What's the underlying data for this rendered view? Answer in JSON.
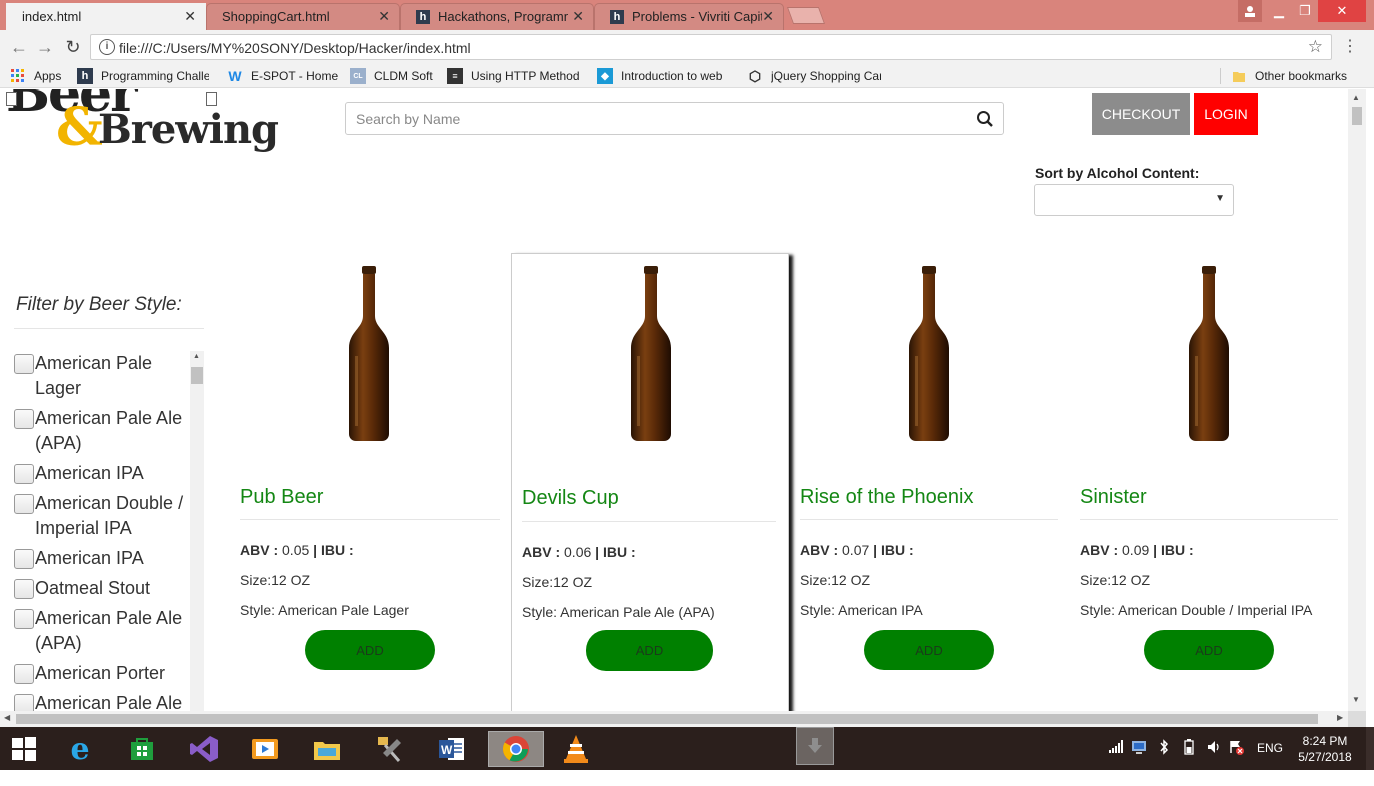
{
  "browser": {
    "tabs": [
      {
        "title": "index.html",
        "icon": "page-icon",
        "active": true
      },
      {
        "title": "ShoppingCart.html",
        "icon": "page-icon",
        "active": false
      },
      {
        "title": "Hackathons, Programmin",
        "icon": "hackerearth-icon",
        "active": false
      },
      {
        "title": "Problems - Vivriti Capital",
        "icon": "hackerearth-icon",
        "active": false
      }
    ],
    "url": "file:///C:/Users/MY%20SONY/Desktop/Hacker/index.html",
    "bookmarks": [
      {
        "label": "Apps",
        "icon": "apps-grid-icon"
      },
      {
        "label": "Programming Challe",
        "icon": "hackerearth-icon"
      },
      {
        "label": "E-SPOT - Home",
        "icon": "w-logo-icon"
      },
      {
        "label": "CLDM Soft",
        "icon": "cldm-icon"
      },
      {
        "label": "Using HTTP Method",
        "icon": "doc-icon"
      },
      {
        "label": "Introduction to web",
        "icon": "web-icon"
      },
      {
        "label": "jQuery Shopping Car",
        "icon": "codepen-icon"
      }
    ],
    "other_bookmarks": "Other bookmarks"
  },
  "header": {
    "logo_top": "Beer",
    "logo_amp": "&",
    "logo_brewing": "Brewing",
    "search_placeholder": "Search by Name",
    "checkout_label": "CHECKOUT",
    "login_label": "LOGIN",
    "colors": {
      "checkout_bg": "#8c8c8c",
      "login_bg": "#ff0000"
    }
  },
  "sort": {
    "label": "Sort by Alcohol Content:",
    "selected": ""
  },
  "filter": {
    "title": "Filter by Beer Style:",
    "items": [
      "American Pale Lager",
      "American Pale Ale (APA)",
      "American IPA",
      "American Double / Imperial IPA",
      "American IPA",
      "Oatmeal Stout",
      "American Pale Ale (APA)",
      "American Porter",
      "American Pale Ale (APA)"
    ]
  },
  "products": [
    {
      "name": "Pub Beer",
      "abv_label": "ABV :",
      "abv": "0.05",
      "ibu_label": "| IBU :",
      "size": "Size:12 OZ",
      "style": "Style: American Pale Lager",
      "add": "ADD"
    },
    {
      "name": "Devils Cup",
      "abv_label": "ABV :",
      "abv": "0.06",
      "ibu_label": "| IBU :",
      "size": "Size:12 OZ",
      "style": "Style: American Pale Ale (APA)",
      "add": "ADD"
    },
    {
      "name": "Rise of the Phoenix",
      "abv_label": "ABV :",
      "abv": "0.07",
      "ibu_label": "| IBU :",
      "size": "Size:12 OZ",
      "style": "Style: American IPA",
      "add": "ADD"
    },
    {
      "name": "Sinister",
      "abv_label": "ABV :",
      "abv": "0.09",
      "ibu_label": "| IBU :",
      "size": "Size:12 OZ",
      "style": "Style: American Double / Imperial IPA",
      "add": "ADD"
    }
  ],
  "theme": {
    "product_name_color": "#148714",
    "add_button_color": "#008000"
  },
  "taskbar": {
    "apps": [
      "windows-start-icon",
      "internet-explorer-icon",
      "store-icon",
      "visual-studio-icon",
      "media-player-icon",
      "file-explorer-icon",
      "tools-icon",
      "word-icon",
      "chrome-icon",
      "vlc-icon"
    ],
    "language": "ENG",
    "time": "8:24 PM",
    "date": "5/27/2018"
  }
}
